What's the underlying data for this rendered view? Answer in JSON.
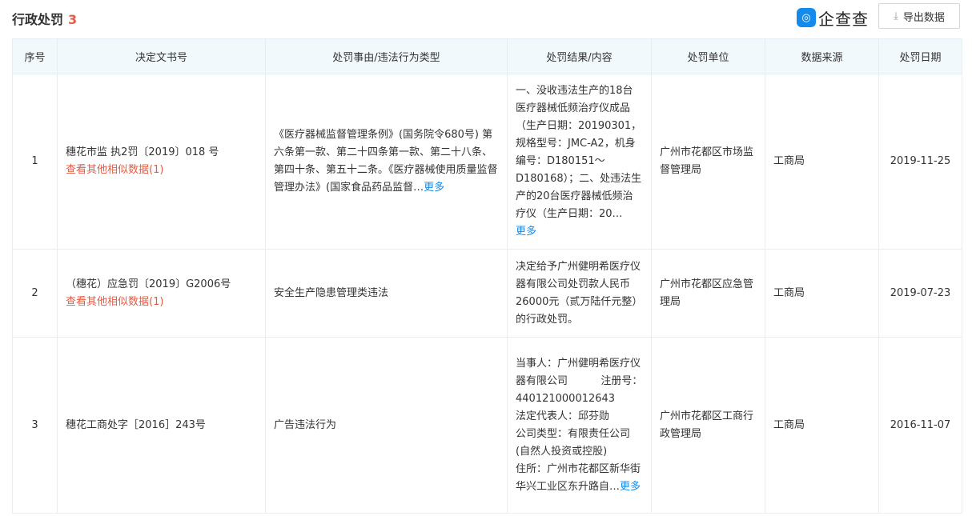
{
  "header": {
    "title": "行政处罚",
    "count": "3",
    "brand": "企查查",
    "brand_icon": "qichacha-logo-icon",
    "export_label": "导出数据",
    "export_icon": "download-icon"
  },
  "table": {
    "columns": [
      "序号",
      "决定文书号",
      "处罚事由/违法行为类型",
      "处罚结果/内容",
      "处罚单位",
      "数据来源",
      "处罚日期"
    ],
    "more_label": "更多",
    "rows": [
      {
        "index": "1",
        "doc_no": "穗花市监 执2罚〔2019〕018 号",
        "similar": "查看其他相似数据(1)",
        "reason": "《医疗器械监督管理条例》(国务院令680号) 第六条第一款、第二十四条第一款、第二十八条、第四十条、第五十二条。《医疗器械使用质量监督管理办法》(国家食品药品监督…",
        "result": "一、没收违法生产的18台医疗器械低频治疗仪成品（生产日期：20190301，规格型号：JMC-A2，机身编号：D180151～D180168）；二、处违法生产的20台医疗器械低频治疗仪（生产日期：20…",
        "unit": "广州市花都区市场监督管理局",
        "source": "工商局",
        "date": "2019-11-25"
      },
      {
        "index": "2",
        "doc_no": "（穗花）应急罚〔2019〕G2006号",
        "similar": "查看其他相似数据(1)",
        "reason": "安全生产隐患管理类违法",
        "result": "决定给予广州健明希医疗仪器有限公司处罚款人民币26000元（贰万陆仟元整）的行政处罚。",
        "unit": "广州市花都区应急管理局",
        "source": "工商局",
        "date": "2019-07-23"
      },
      {
        "index": "3",
        "doc_no": "穗花工商处字［2016］243号",
        "reason": "广告违法行为",
        "result": "当事人：广州健明希医疗仪器有限公司          注册号：440121000012643          法定代表人：邱芬勋          公司类型：有限责任公司(自然人投资或控股)          住所：广州市花都区新华街华兴工业区东升路自…",
        "unit": "广州市花都区工商行政管理局",
        "source": "工商局",
        "date": "2016-11-07"
      }
    ]
  }
}
